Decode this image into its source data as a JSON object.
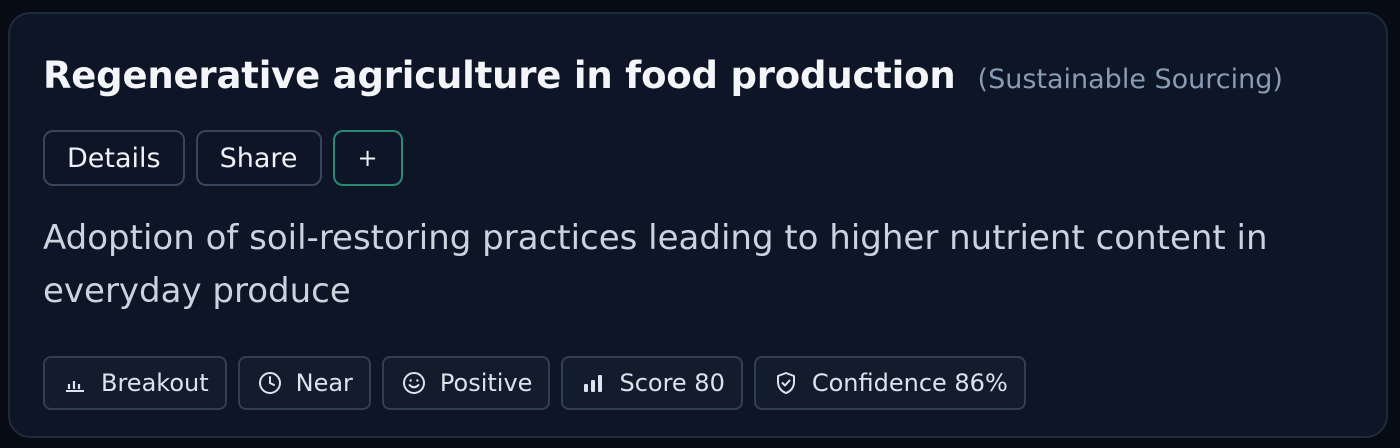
{
  "card": {
    "title": "Regenerative agriculture in food production",
    "category": "(Sustainable Sourcing)",
    "actions": {
      "details_label": "Details",
      "share_label": "Share",
      "add_label": "+"
    },
    "description": "Adoption of soil-restoring practices leading to higher nutrient content in everyday produce",
    "tags": [
      {
        "label": "Breakout",
        "icon": "trend-bars-icon"
      },
      {
        "label": "Near",
        "icon": "clock-icon"
      },
      {
        "label": "Positive",
        "icon": "smiley-icon"
      },
      {
        "label": "Score 80",
        "icon": "score-bars-icon"
      },
      {
        "label": "Confidence 86%",
        "icon": "shield-check-icon"
      }
    ]
  },
  "colors": {
    "background": "#070b14",
    "card": "#0d1526",
    "accent": "#2a8a74",
    "muted_text": "#8a9bb4"
  }
}
